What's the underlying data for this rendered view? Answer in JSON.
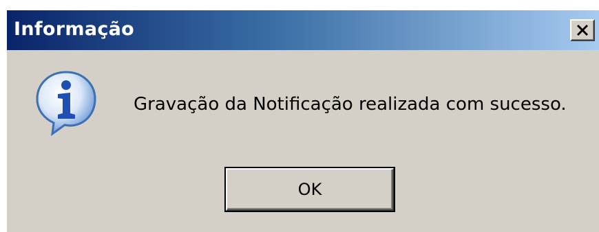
{
  "window": {
    "title": "Informação",
    "close_label": "X"
  },
  "dialog": {
    "icon": "info-speech-bubble-icon",
    "message": "Gravação da Notificação realizada com sucesso.",
    "ok_label": "OK"
  },
  "colors": {
    "titlebar_start": "#0a246a",
    "titlebar_end": "#a6caf0",
    "dialog_background": "#d4d0c8",
    "title_text": "#ffffff"
  }
}
